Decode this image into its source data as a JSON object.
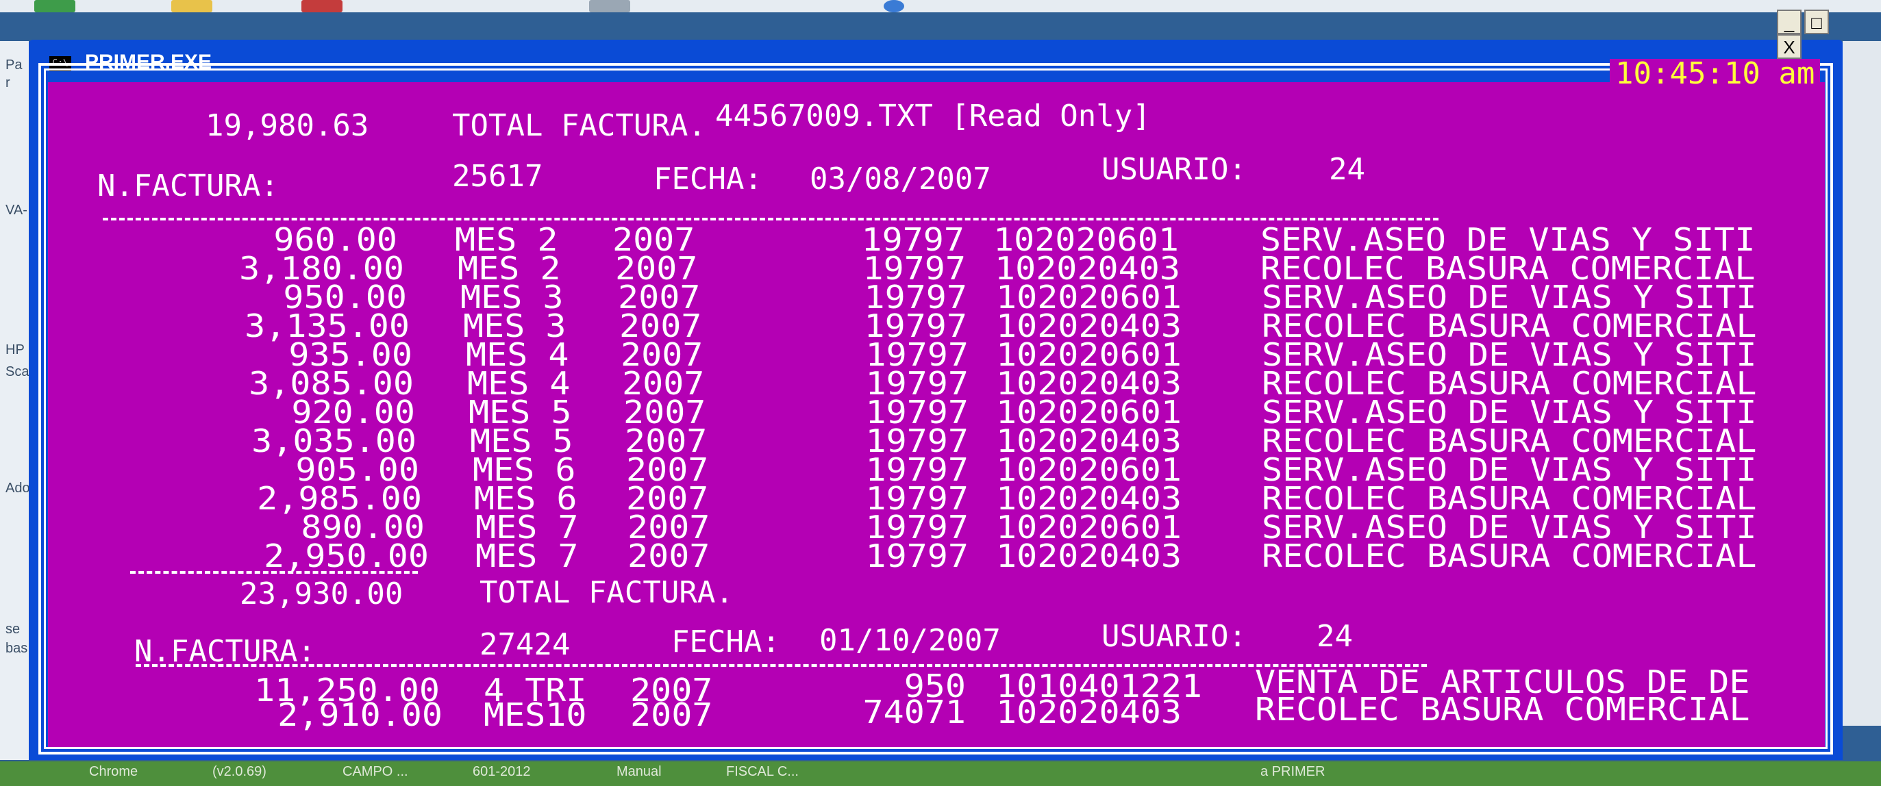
{
  "window": {
    "title": "PRIMER.EXE",
    "sys_icon": "C:\\",
    "buttons": [
      "_",
      "□",
      "X"
    ]
  },
  "console": {
    "file_title": "44567009.TXT [Read Only]",
    "clock": "10:45:10 am",
    "colors": {
      "background": "#b400b4",
      "text": "#ffffff",
      "clock": "#ffff3a"
    },
    "invoices": [
      {
        "total_before": "19,980.63",
        "total_label": "TOTAL FACTURA.",
        "num_label": "N.FACTURA:",
        "num": "25617",
        "date_label": "FECHA:",
        "date": "03/08/2007",
        "user_label": "USUARIO:",
        "user": "24",
        "rows": [
          [
            "960.00",
            "MES 2",
            "2007",
            "19797",
            "102020601",
            "SERV.ASEO DE VIAS Y SITI"
          ],
          [
            "3,180.00",
            "MES 2",
            "2007",
            "19797",
            "102020403",
            "RECOLEC BASURA COMERCIAL"
          ],
          [
            "950.00",
            "MES 3",
            "2007",
            "19797",
            "102020601",
            "SERV.ASEO DE VIAS Y SITI"
          ],
          [
            "3,135.00",
            "MES 3",
            "2007",
            "19797",
            "102020403",
            "RECOLEC BASURA COMERCIAL"
          ],
          [
            "935.00",
            "MES 4",
            "2007",
            "19797",
            "102020601",
            "SERV.ASEO DE VIAS Y SITI"
          ],
          [
            "3,085.00",
            "MES 4",
            "2007",
            "19797",
            "102020403",
            "RECOLEC BASURA COMERCIAL"
          ],
          [
            "920.00",
            "MES 5",
            "2007",
            "19797",
            "102020601",
            "SERV.ASEO DE VIAS Y SITI"
          ],
          [
            "3,035.00",
            "MES 5",
            "2007",
            "19797",
            "102020403",
            "RECOLEC BASURA COMERCIAL"
          ],
          [
            "905.00",
            "MES 6",
            "2007",
            "19797",
            "102020601",
            "SERV.ASEO DE VIAS Y SITI"
          ],
          [
            "2,985.00",
            "MES 6",
            "2007",
            "19797",
            "102020403",
            "RECOLEC BASURA COMERCIAL"
          ],
          [
            "890.00",
            "MES 7",
            "2007",
            "19797",
            "102020601",
            "SERV.ASEO DE VIAS Y SITI"
          ],
          [
            "2,950.00",
            "MES 7",
            "2007",
            "19797",
            "102020403",
            "RECOLEC BASURA COMERCIAL"
          ]
        ]
      },
      {
        "total_before": "23,930.00",
        "total_label": "TOTAL FACTURA.",
        "num_label": "N.FACTURA:",
        "num": "27424",
        "date_label": "FECHA:",
        "date": "01/10/2007",
        "user_label": "USUARIO:",
        "user": "24",
        "rows": [
          [
            "11,250.00",
            "4 TRI",
            "2007",
            "950",
            "1010401221",
            "VENTA DE ARTICULOS DE DE"
          ],
          [
            "2,910.00",
            "MES10",
            "2007",
            "74071",
            "102020403",
            "RECOLEC BASURA COMERCIAL"
          ]
        ]
      }
    ]
  },
  "desktop": {
    "left_labels": [
      "Pa",
      "r",
      "VA-",
      "HP",
      "Sca",
      "Ado",
      "se",
      "bas"
    ],
    "taskbar_items": [
      "Chrome",
      "(v2.0.69)",
      "CAMPO ...",
      "601-2012",
      "Manual",
      "FISCAL C...",
      "a PRIMER"
    ]
  }
}
